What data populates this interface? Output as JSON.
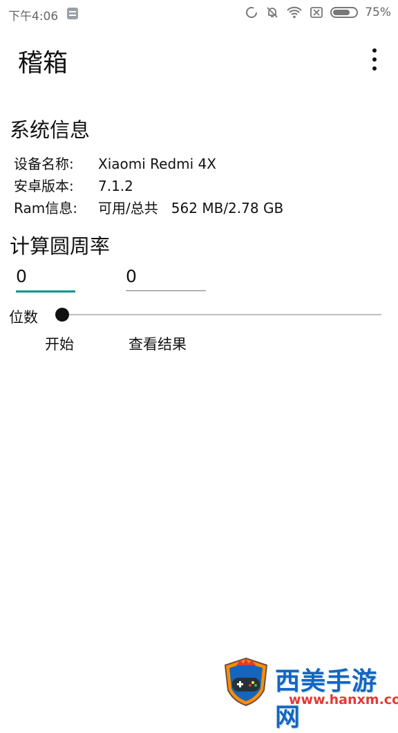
{
  "status_bar": {
    "time": "下午4:06",
    "battery_percent": "75%",
    "battery_level": 0.75,
    "icons": [
      "notification-app-icon",
      "sync-icon",
      "mute-bell-icon",
      "wifi-icon",
      "sim-blocked-icon",
      "battery-icon"
    ]
  },
  "app_bar": {
    "title": "稽箱",
    "menu_icon": "more-vert-icon"
  },
  "system_info": {
    "heading": "系统信息",
    "rows": [
      {
        "label": "设备名称:",
        "value": "Xiaomi Redmi 4X"
      },
      {
        "label": "安卓版本:",
        "value": "7.1.2"
      },
      {
        "label": "Ram信息:",
        "value": "可用/总共   562 MB/2.78 GB"
      }
    ]
  },
  "pi_calc": {
    "heading": "计算圆周率",
    "input_a_value": "0",
    "input_b_value": "0",
    "digits_label": "位数",
    "slider_value": 0,
    "start_label": "开始",
    "result_label": "查看结果"
  },
  "watermark": {
    "name": "西美手游网",
    "url": "www.hanxm.com"
  },
  "colors": {
    "accent": "#009688",
    "watermark_blue": "#1565c0",
    "watermark_red": "#e53935"
  }
}
